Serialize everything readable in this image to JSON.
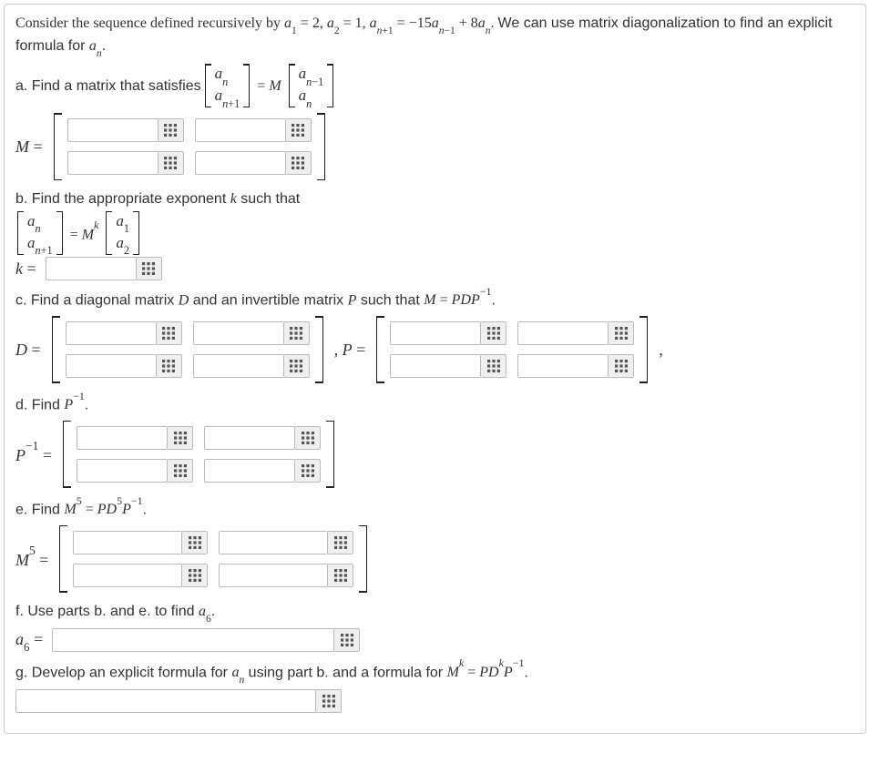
{
  "intro": "Consider the sequence defined recursively by a₁ = 2, a₂ = 1, aₙ₊₁ = −15aₙ₋₁ + 8aₙ. We can use matrix diagonalization to find an explicit formula for aₙ.",
  "parts": {
    "a": {
      "text": "a. Find a matrix that satisfies ",
      "lhs": "M ="
    },
    "b": {
      "text": "b. Find the appropriate exponent k such that",
      "lhs": "k ="
    },
    "c": {
      "text": "c. Find a diagonal matrix D and an invertible matrix P such that M = PDP⁻¹.",
      "lhsD": "D =",
      "lhsP": ", P ="
    },
    "d": {
      "text": "d. Find P⁻¹.",
      "lhs": "P⁻¹ ="
    },
    "e": {
      "text": "e. Find M⁵ = PD⁵P⁻¹.",
      "lhs": "M⁵ ="
    },
    "f": {
      "text": "f. Use parts b. and e. to find a₆.",
      "lhs": "a₆ ="
    },
    "g": {
      "text": "g. Develop an explicit formula for aₙ using part b. and a formula for Mᵏ = PDᵏP⁻¹."
    }
  },
  "vectors": {
    "an_anp1": [
      "aₙ",
      "aₙ₊₁"
    ],
    "anm1_an": [
      "aₙ₋₁",
      "aₙ"
    ],
    "a1_a2": [
      "a₁",
      "a₂"
    ]
  },
  "trailing_comma": ","
}
